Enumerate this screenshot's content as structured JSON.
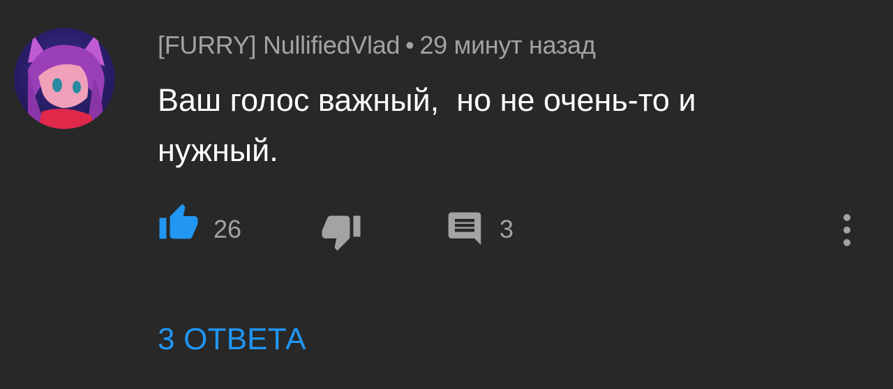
{
  "comment": {
    "author": "[FURRY] NullifiedVlad",
    "separator": "•",
    "time": "29 минут назад",
    "text": "Ваш голос важный,  но не очень-то и нужный.",
    "avatar_icon": "anime-character-avatar"
  },
  "actions": {
    "like_icon": "thumbs-up-icon",
    "like_count": "26",
    "liked": true,
    "dislike_icon": "thumbs-down-icon",
    "reply_icon": "comment-icon",
    "reply_count": "3",
    "more_icon": "more-vertical-icon"
  },
  "replies": {
    "label": "3 ОТВЕТА"
  },
  "colors": {
    "background": "#282828",
    "text_primary": "#ffffff",
    "text_secondary": "#a3a3a3",
    "accent": "#2196f3"
  }
}
